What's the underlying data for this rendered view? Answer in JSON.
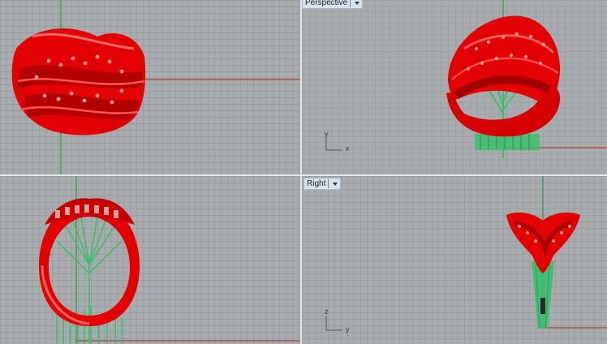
{
  "viewports": {
    "perspective": {
      "label": "Perspective"
    },
    "right": {
      "label": "Right"
    }
  },
  "axes": {
    "perspective": {
      "x": "x",
      "y": "y"
    },
    "right": {
      "z": "z",
      "y": "y"
    }
  },
  "colors": {
    "model": "#e00000",
    "supports": "#3cbf6c",
    "x_axis": "#b43a3a",
    "y_axis": "#1f9a3a"
  }
}
